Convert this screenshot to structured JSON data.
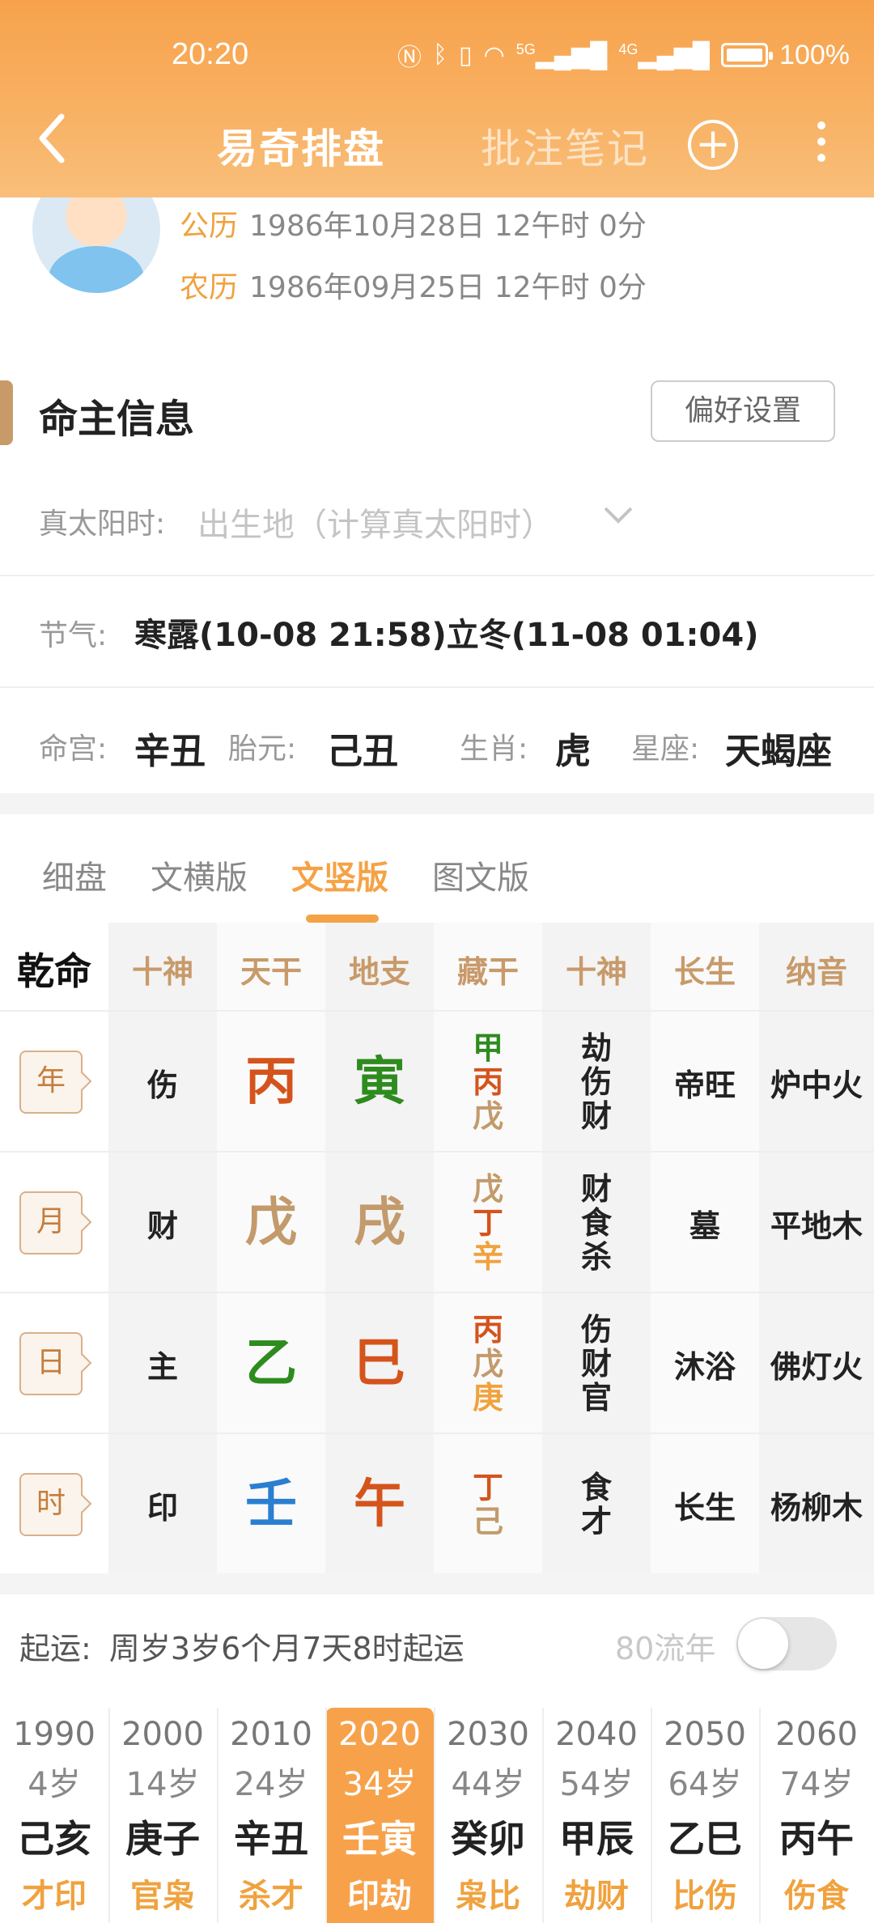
{
  "status_bar": {
    "time": "20:20",
    "battery": "100%",
    "icons": [
      "nfc-icon",
      "bluetooth-icon",
      "vibrate-icon",
      "wifi-icon",
      "5g-signal-icon",
      "4g-signal-icon",
      "battery-icon"
    ],
    "sig1": "5G",
    "sig2": "4G"
  },
  "nav": {
    "title": "易奇排盘",
    "notes": "批注笔记",
    "back_icon": "chevron-left-icon",
    "add_icon": "plus-circle-icon",
    "more_icon": "more-vertical-icon"
  },
  "profile": {
    "solar_label": "公历",
    "solar_value": "1986年10月28日 12午时 0分",
    "lunar_label": "农历",
    "lunar_value": "1986年09月25日 12午时 0分"
  },
  "info": {
    "title": "命主信息",
    "pref_button": "偏好设置",
    "true_solar_label": "真太阳时:",
    "true_solar_placeholder": "出生地（计算真太阳时）",
    "jieqi_label": "节气:",
    "jieqi_value": "寒露(10-08 21:58)立冬(11-08 01:04)",
    "minggong_label": "命宫:",
    "minggong_value": "辛丑",
    "taiyuan_label": "胎元:",
    "taiyuan_value": "己丑",
    "shengxiao_label": "生肖:",
    "shengxiao_value": "虎",
    "xingzuo_label": "星座:",
    "xingzuo_value": "天蝎座"
  },
  "tabs": [
    "细盘",
    "文横版",
    "文竖版",
    "图文版"
  ],
  "active_tab": "文竖版",
  "table": {
    "corner": "乾命",
    "headers": [
      "十神",
      "天干",
      "地支",
      "藏干",
      "十神",
      "长生",
      "纳音"
    ],
    "rows": [
      {
        "pillar": "年",
        "shishen": "伤",
        "gan": "丙",
        "gan_color": "#d4541c",
        "zhi": "寅",
        "zhi_color": "#2e8b1e",
        "canggan": [
          {
            "t": "甲",
            "c": "#2e8b1e"
          },
          {
            "t": "丙",
            "c": "#d4541c"
          },
          {
            "t": "戊",
            "c": "#c39a6b"
          }
        ],
        "shishen2": [
          "劫",
          "伤",
          "财"
        ],
        "changsheng": "帝旺",
        "nayin": "炉中火"
      },
      {
        "pillar": "月",
        "shishen": "财",
        "gan": "戊",
        "gan_color": "#c39a6b",
        "zhi": "戌",
        "zhi_color": "#c39a6b",
        "canggan": [
          {
            "t": "戊",
            "c": "#c39a6b"
          },
          {
            "t": "丁",
            "c": "#d4541c"
          },
          {
            "t": "辛",
            "c": "#f0a23e"
          }
        ],
        "shishen2": [
          "财",
          "食",
          "杀"
        ],
        "changsheng": "墓",
        "nayin": "平地木"
      },
      {
        "pillar": "日",
        "shishen": "主",
        "gan": "乙",
        "gan_color": "#2e8b1e",
        "zhi": "巳",
        "zhi_color": "#d4541c",
        "canggan": [
          {
            "t": "丙",
            "c": "#d4541c"
          },
          {
            "t": "戊",
            "c": "#c39a6b"
          },
          {
            "t": "庚",
            "c": "#f0a23e"
          }
        ],
        "shishen2": [
          "伤",
          "财",
          "官"
        ],
        "changsheng": "沐浴",
        "nayin": "佛灯火"
      },
      {
        "pillar": "时",
        "shishen": "印",
        "gan": "壬",
        "gan_color": "#2a7fd0",
        "zhi": "午",
        "zhi_color": "#d4541c",
        "canggan": [
          {
            "t": "丁",
            "c": "#d4541c"
          },
          {
            "t": "己",
            "c": "#c39a6b"
          }
        ],
        "shishen2": [
          "食",
          "才"
        ],
        "changsheng": "长生",
        "nayin": "杨柳木"
      }
    ]
  },
  "luck": {
    "label": "起运:",
    "value": "周岁3岁6个月7天8时起运",
    "toggle_label": "80流年",
    "toggle_on": false,
    "dayun": [
      {
        "year": "1990",
        "age": "4岁",
        "gz": "己亥",
        "sh": "才印"
      },
      {
        "year": "2000",
        "age": "14岁",
        "gz": "庚子",
        "sh": "官枭"
      },
      {
        "year": "2010",
        "age": "24岁",
        "gz": "辛丑",
        "sh": "杀才"
      },
      {
        "year": "2020",
        "age": "34岁",
        "gz": "壬寅",
        "sh": "印劫",
        "active": true
      },
      {
        "year": "2030",
        "age": "44岁",
        "gz": "癸卯",
        "sh": "枭比"
      },
      {
        "year": "2040",
        "age": "54岁",
        "gz": "甲辰",
        "sh": "劫财"
      },
      {
        "year": "2050",
        "age": "64岁",
        "gz": "乙巳",
        "sh": "比伤"
      },
      {
        "year": "2060",
        "age": "74岁",
        "gz": "丙午",
        "sh": "伤食"
      }
    ]
  }
}
